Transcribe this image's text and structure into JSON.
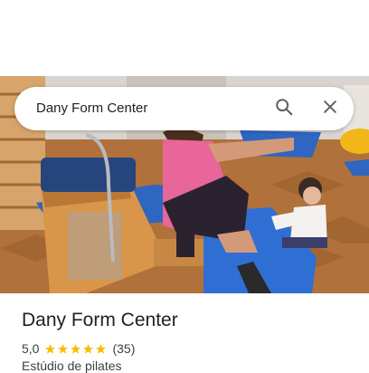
{
  "search": {
    "value": "Dany Form Center",
    "search_icon": "search-icon",
    "clear_icon": "close-icon"
  },
  "photo": {
    "subject": "place-photo"
  },
  "place": {
    "name": "Dany Form Center",
    "rating": "5,0",
    "stars": 5,
    "review_count": "(35)",
    "category": "Estúdio de pilates"
  },
  "colors": {
    "star": "#fbbc04",
    "text_primary": "#202124",
    "text_secondary": "#3c4043",
    "icon": "#5f6368"
  }
}
